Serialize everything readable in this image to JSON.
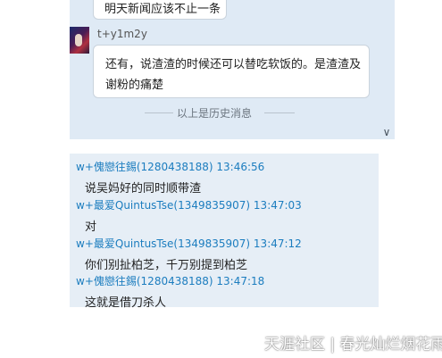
{
  "history": {
    "top_bubble_text": "明天新闻应该不止一条",
    "sender": "t+y1m2y",
    "message_lines": [
      "还有，说渣渣的时候还可以替吃软饭的。是渣渣及",
      "谢粉的痛楚"
    ],
    "divider_label": "以上是历史消息"
  },
  "chat": {
    "messages": [
      {
        "header": "w+傀戀往錫(1280438188) 13:46:56",
        "body": "说吴妈好的同时顺带渣"
      },
      {
        "header": "w+最爱QuintusTse(1349835907) 13:47:03",
        "body": "对"
      },
      {
        "header": "w+最爱QuintusTse(1349835907) 13:47:12",
        "body": "你们别扯柏芝，千万别提到柏芝"
      },
      {
        "header": "w+傀戀往錫(1280438188) 13:47:18",
        "body": "这就是借刀杀人"
      }
    ]
  },
  "watermark": "天涯社区 | 春光灿烂烟花雨",
  "colors": {
    "history_bg": "#dfeaf5",
    "chat_bg": "#e6eef6",
    "header_blue": "#1c7dbf"
  }
}
